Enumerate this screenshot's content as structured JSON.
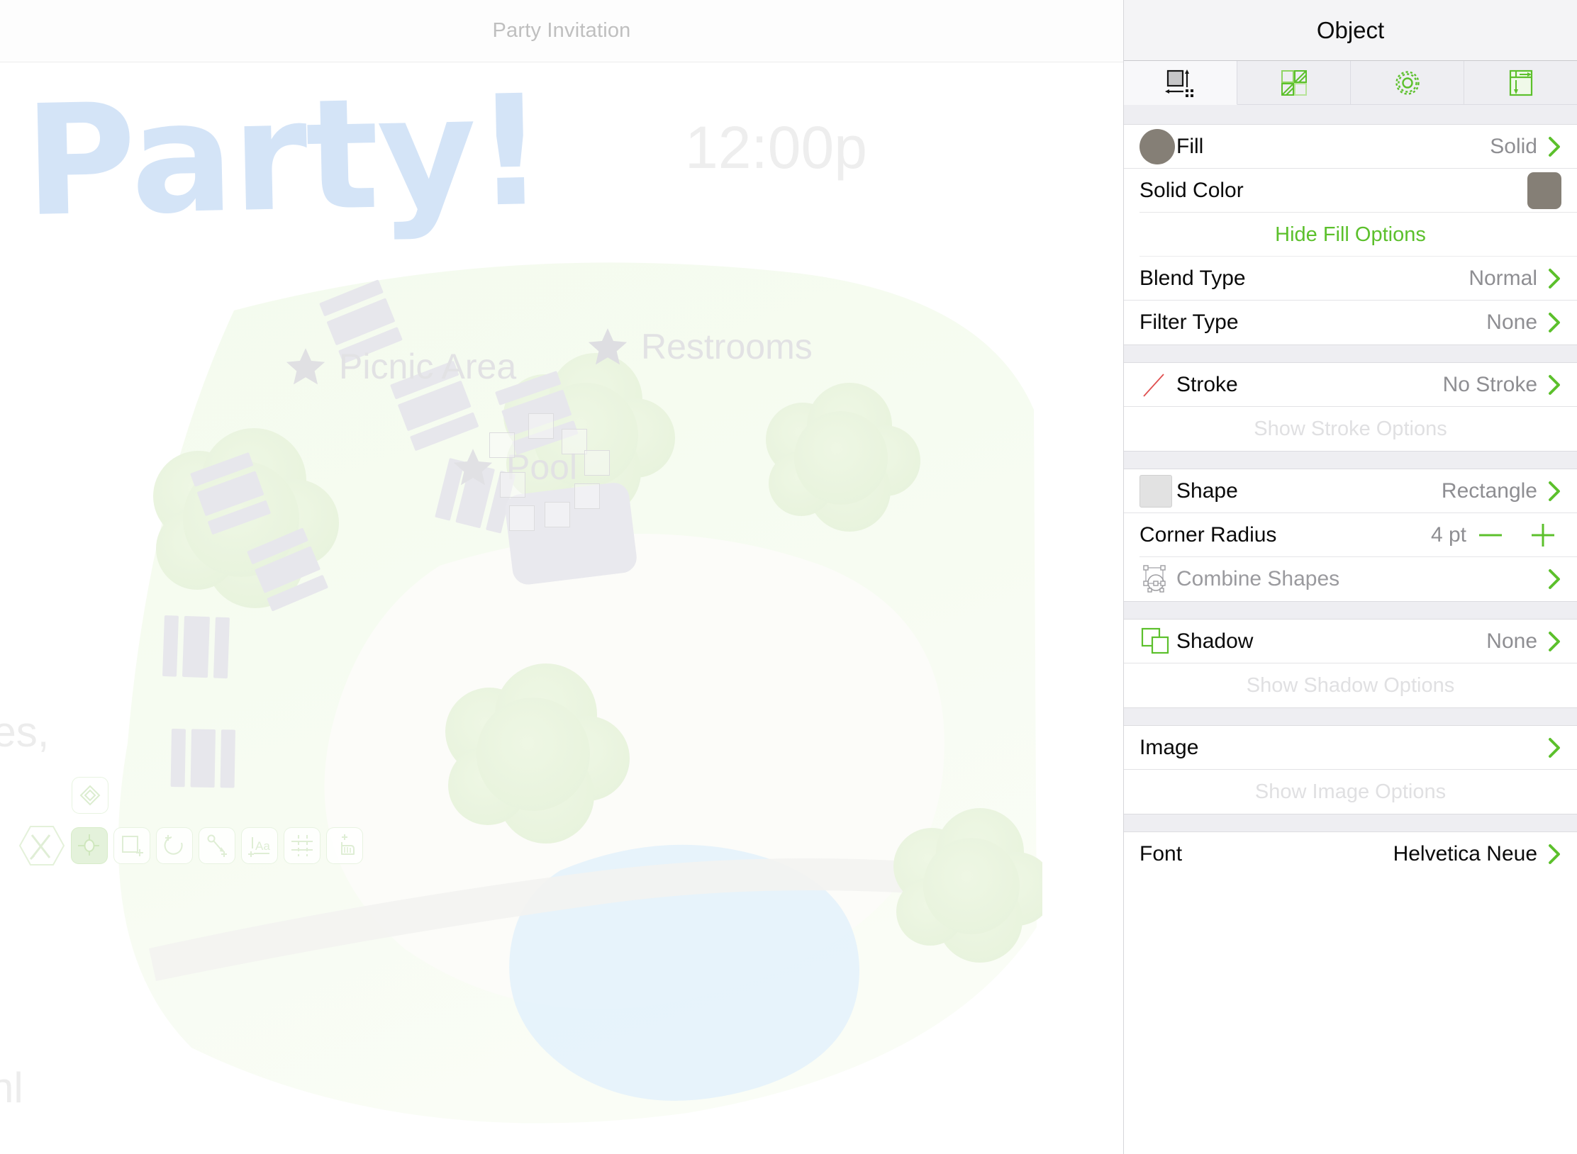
{
  "document": {
    "title": "Party Invitation",
    "hero_text": "l Party!",
    "time_text": "12:00p",
    "body_snippet_1": "les,",
    "body_snippet_2": "nl"
  },
  "map": {
    "markers": [
      {
        "id": "picnic",
        "label": "Picnic Area",
        "icon": "star-icon"
      },
      {
        "id": "restrooms",
        "label": "Restrooms",
        "icon": "star-icon"
      },
      {
        "id": "pool",
        "label": "Pool",
        "icon": "star-icon"
      }
    ]
  },
  "toolbar": {
    "shape_popover": {
      "name": "diamond-shape-icon"
    },
    "tools": [
      {
        "id": "draw",
        "icon": "pencil-pen-cross-icon",
        "active": false
      },
      {
        "id": "point",
        "icon": "point-select-icon",
        "active": true
      },
      {
        "id": "rectangle",
        "icon": "add-rectangle-icon",
        "active": false
      },
      {
        "id": "circle",
        "icon": "add-circle-icon",
        "active": false
      },
      {
        "id": "pen",
        "icon": "add-pen-path-icon",
        "active": false
      },
      {
        "id": "text",
        "icon": "add-text-icon",
        "active": false
      },
      {
        "id": "crop",
        "icon": "add-guides-icon",
        "active": false
      },
      {
        "id": "touch",
        "icon": "touch-hand-icon",
        "active": false
      }
    ]
  },
  "inspector": {
    "title": "Object",
    "tabs": [
      {
        "id": "geometry",
        "icon": "size-arrows-icon",
        "selected": true
      },
      {
        "id": "style",
        "icon": "fill-pattern-icon",
        "selected": false
      },
      {
        "id": "settings",
        "icon": "gear-icon",
        "selected": false
      },
      {
        "id": "layout",
        "icon": "text-layout-icon",
        "selected": false
      }
    ],
    "colors": {
      "accent_green": "#5cc02c",
      "fill_swatch": "#857f76",
      "shape_swatch": "#e2e2e2",
      "stroke_icon": "#e05050"
    },
    "sections": [
      {
        "id": "fill",
        "rows": [
          {
            "id": "fill",
            "type": "value",
            "icon": "fill-color-circle-icon",
            "label": "Fill",
            "value": "Solid",
            "chevron": true
          },
          {
            "id": "solid-color",
            "type": "swatch",
            "label": "Solid Color",
            "swatch": "#857f76"
          }
        ],
        "link": {
          "id": "hide-fill-options",
          "label": "Hide Fill Options",
          "state": "enabled"
        },
        "extra_rows": [
          {
            "id": "blend-type",
            "type": "value",
            "label": "Blend Type",
            "value": "Normal",
            "chevron": true
          },
          {
            "id": "filter-type",
            "type": "value",
            "label": "Filter Type",
            "value": "None",
            "chevron": true
          }
        ]
      },
      {
        "id": "stroke",
        "rows": [
          {
            "id": "stroke",
            "type": "value",
            "icon": "stroke-line-icon",
            "label": "Stroke",
            "value": "No Stroke",
            "chevron": true
          }
        ],
        "link": {
          "id": "show-stroke-options",
          "label": "Show Stroke Options",
          "state": "disabled"
        }
      },
      {
        "id": "shape",
        "rows": [
          {
            "id": "shape",
            "type": "value",
            "icon": "shape-swatch-icon",
            "label": "Shape",
            "value": "Rectangle",
            "chevron": true
          },
          {
            "id": "corner-radius",
            "type": "stepper",
            "label": "Corner Radius",
            "value": "4 pt",
            "minus": "minus-icon",
            "plus": "plus-icon"
          },
          {
            "id": "combine-shapes",
            "type": "nav",
            "icon": "combine-shapes-icon",
            "label": "Combine Shapes",
            "muted": true,
            "chevron": true
          }
        ]
      },
      {
        "id": "shadow",
        "rows": [
          {
            "id": "shadow",
            "type": "value",
            "icon": "shadow-squares-icon",
            "label": "Shadow",
            "value": "None",
            "chevron": true
          }
        ],
        "link": {
          "id": "show-shadow-options",
          "label": "Show Shadow Options",
          "state": "disabled"
        }
      },
      {
        "id": "image",
        "rows": [
          {
            "id": "image",
            "type": "nav",
            "label": "Image",
            "chevron": true
          }
        ],
        "link": {
          "id": "show-image-options",
          "label": "Show Image Options",
          "state": "disabled"
        }
      },
      {
        "id": "font",
        "rows": [
          {
            "id": "font",
            "type": "value",
            "label": "Font",
            "value": "Helvetica Neue",
            "value_dark": true,
            "chevron": true
          }
        ]
      }
    ]
  }
}
